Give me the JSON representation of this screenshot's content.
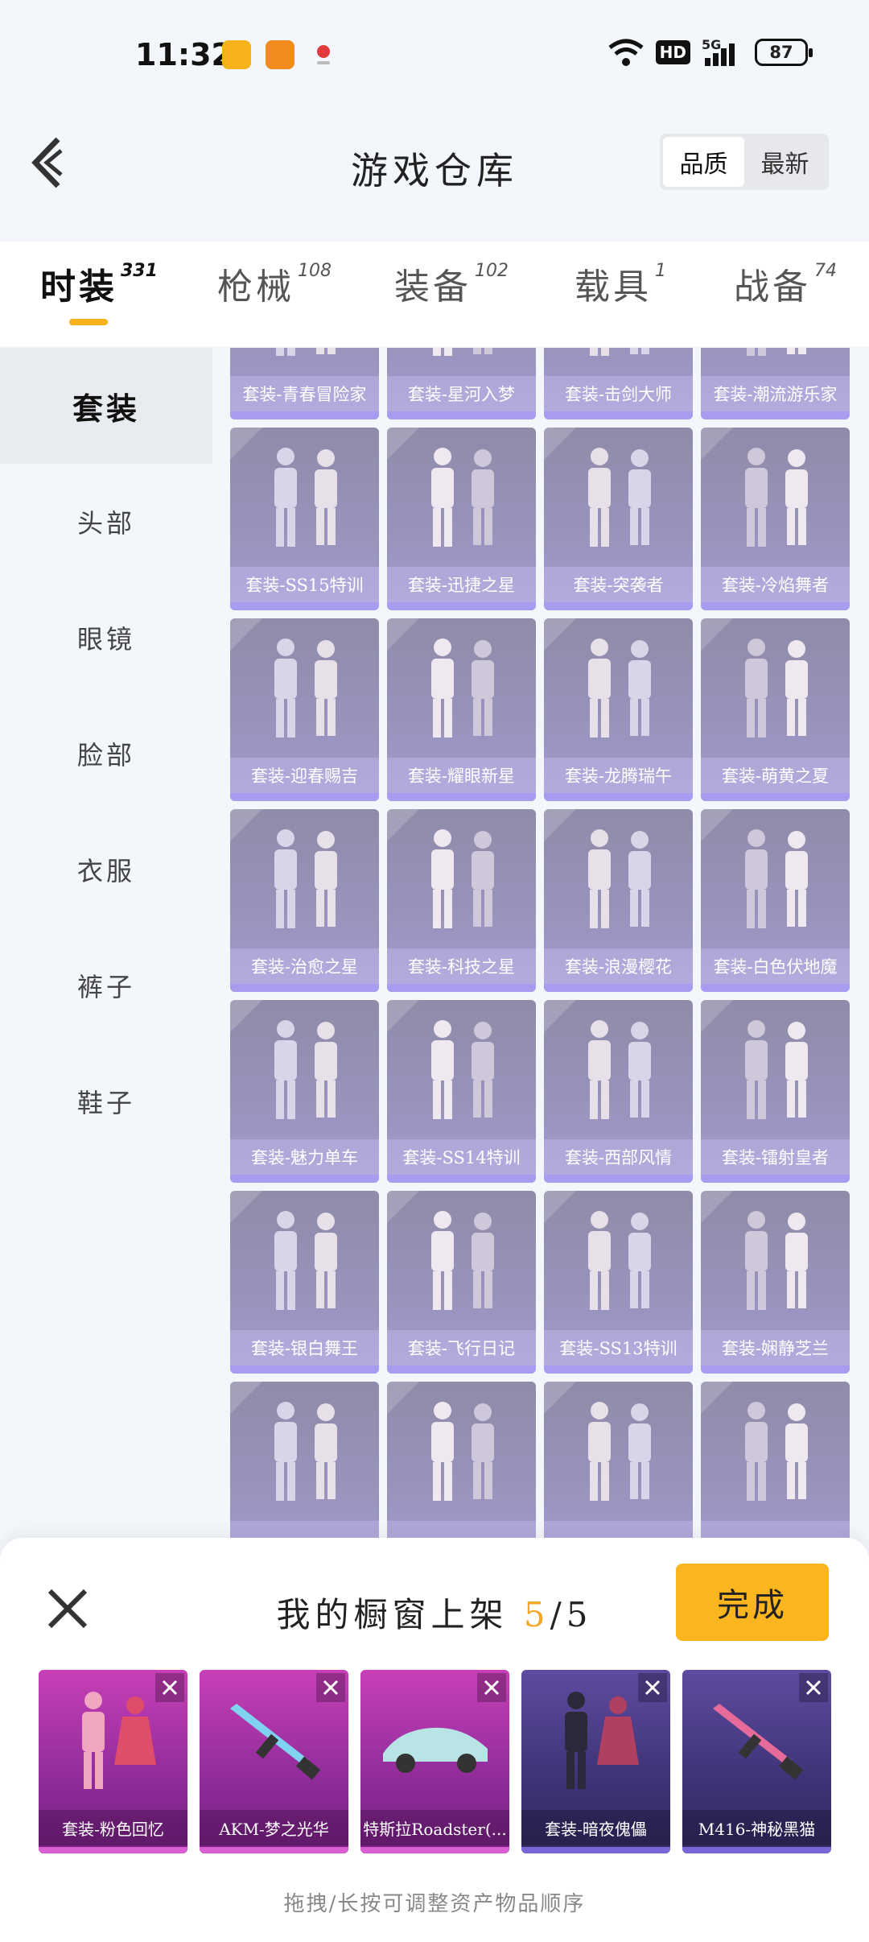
{
  "status_bar": {
    "time": "11:32",
    "hd": "HD",
    "network": "5G",
    "battery": "87"
  },
  "header": {
    "title": "游戏仓库",
    "sort_options": [
      "品质",
      "最新"
    ],
    "active_sort": "品质"
  },
  "tabs": [
    {
      "label": "时装",
      "count": "331"
    },
    {
      "label": "枪械",
      "count": "108"
    },
    {
      "label": "装备",
      "count": "102"
    },
    {
      "label": "载具",
      "count": "1"
    },
    {
      "label": "战备",
      "count": "74"
    }
  ],
  "sidebar": {
    "items": [
      {
        "label": "套装"
      },
      {
        "label": "头部"
      },
      {
        "label": "眼镜"
      },
      {
        "label": "脸部"
      },
      {
        "label": "衣服"
      },
      {
        "label": "裤子"
      },
      {
        "label": "鞋子"
      }
    ]
  },
  "grid": {
    "items": [
      {
        "name": "套装-青春冒险家"
      },
      {
        "name": "套装-星河入梦"
      },
      {
        "name": "套装-击剑大师"
      },
      {
        "name": "套装-潮流游乐家"
      },
      {
        "name": "套装-SS15特训"
      },
      {
        "name": "套装-迅捷之星"
      },
      {
        "name": "套装-突袭者"
      },
      {
        "name": "套装-冷焰舞者"
      },
      {
        "name": "套装-迎春赐吉"
      },
      {
        "name": "套装-耀眼新星"
      },
      {
        "name": "套装-龙腾瑞午"
      },
      {
        "name": "套装-萌黄之夏"
      },
      {
        "name": "套装-治愈之星"
      },
      {
        "name": "套装-科技之星"
      },
      {
        "name": "套装-浪漫樱花"
      },
      {
        "name": "套装-白色伏地魔"
      },
      {
        "name": "套装-魅力单车"
      },
      {
        "name": "套装-SS14特训"
      },
      {
        "name": "套装-西部风情"
      },
      {
        "name": "套装-镭射皇者"
      },
      {
        "name": "套装-银白舞王"
      },
      {
        "name": "套装-飞行日记"
      },
      {
        "name": "套装-SS13特训"
      },
      {
        "name": "套装-娴静芝兰"
      },
      {
        "name": ""
      },
      {
        "name": ""
      },
      {
        "name": ""
      },
      {
        "name": ""
      }
    ]
  },
  "showcase": {
    "title_prefix": "我的橱窗上架",
    "current": "5",
    "separator": "/",
    "max": "5",
    "done_label": "完成",
    "items": [
      {
        "name": "套装-粉色回忆",
        "tone": "purple"
      },
      {
        "name": "AKM-梦之光华",
        "tone": "purple"
      },
      {
        "name": "特斯拉Roadster(...",
        "tone": "purple"
      },
      {
        "name": "套装-暗夜傀儡",
        "tone": "violet"
      },
      {
        "name": "M416-神秘黑猫",
        "tone": "violet"
      }
    ],
    "hint": "拖拽/长按可调整资产物品顺序"
  },
  "colors": {
    "accent": "#f5b21a",
    "done_button": "#fbb51f",
    "card_bg": "#9b95c1",
    "slot_purple": "#b23aa6",
    "slot_violet": "#4a3d8a"
  }
}
